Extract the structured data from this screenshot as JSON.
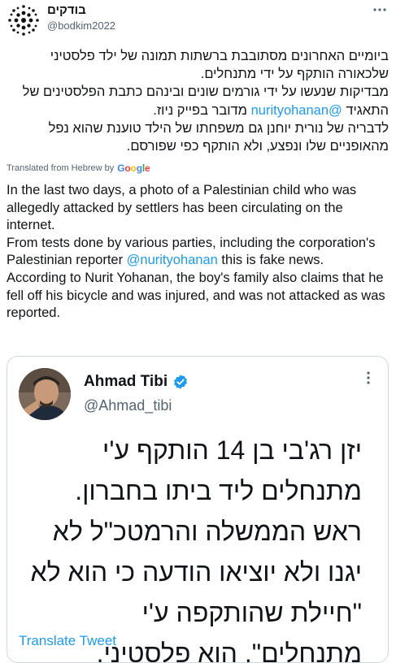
{
  "author": {
    "name": "בודקים",
    "handle": "@bodkim2022"
  },
  "tweet": {
    "hebrew": {
      "line1": "ביומיים האחרונים מסתובבת ברשתות תמונה של ילד פלסטיני שלכאורה הותקף על ידי מתנחלים.",
      "line2_pre": "מבדיקות שנעשו על ידי גורמים שונים ובינהם כתבת הפלסטינים של התאגיד ",
      "mention": "@nurityohanan",
      "line2_post": " מדובר בפייק ניוז.",
      "line3": "לדבריה של נורית יוחנן גם משפחתו של הילד טוענת שהוא נפל מהאופניים שלו ונפצע, ולא הותקף כפי שפורסם."
    },
    "translated_label": "Translated from Hebrew by",
    "google_label": "Google",
    "english": {
      "p1": "In the last two days, a photo of a Palestinian child who was allegedly attacked by settlers has been circulating on the internet.",
      "p2_pre": "From tests done by various parties, including the corporation's Palestinian reporter ",
      "mention": "@nurityohanan",
      "p2_post": " this is fake news.",
      "p3": "According to Nurit Yohanan, the boy's family also claims that he fell off his bicycle and was injured, and was not attacked as was reported."
    }
  },
  "quote": {
    "name": "Ahmad Tibi",
    "handle": "@Ahmad_tibi",
    "text": "יזן רג'בי בן 14 הותקף ע'י מתנחלים ליד ביתו בחברון. ראש הממשלה והרמטכ\"ל לא יגנו ולא יוציאו הודעה כי הוא לא \"חיילת שהותקפה ע'י מתנחלים\". הוא פלסטיני.",
    "translate_label": "Translate Tweet"
  },
  "icons": {
    "more": "more-horizontal-icon",
    "verified": "verified-badge-icon",
    "logo": "bodkim-dotted-circle-logo"
  },
  "colors": {
    "link": "#1d9bf0",
    "secondary": "#536471",
    "border": "#cfd9de"
  }
}
